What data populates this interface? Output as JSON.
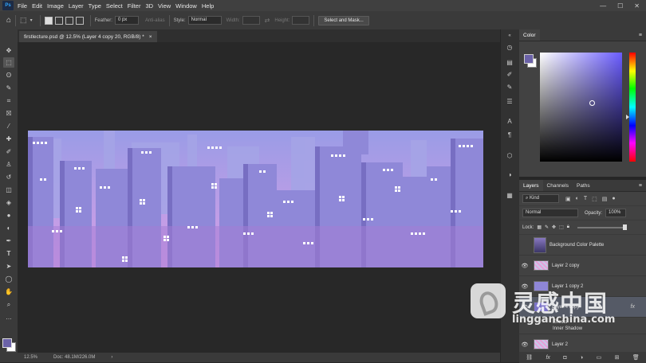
{
  "menu": {
    "app_icon_label": "Ps",
    "items": [
      "File",
      "Edit",
      "Image",
      "Layer",
      "Type",
      "Select",
      "Filter",
      "3D",
      "View",
      "Window",
      "Help"
    ],
    "window_controls": [
      "—",
      "☐",
      "✕"
    ]
  },
  "options_bar": {
    "feather_label": "Feather:",
    "feather_value": "0 px",
    "antialias_label": "Anti-alias",
    "style_label": "Style:",
    "style_value": "Normal",
    "width_label": "Width:",
    "height_label": "Height:",
    "select_mask_button": "Select and Mask..."
  },
  "document": {
    "tab_title": "firstlecture.psd @ 12.5% (Layer 4 copy 20, RGB/8) *",
    "close_glyph": "×"
  },
  "status": {
    "zoom": "12.5%",
    "doc_size": "Doc: 48.1M/226.0M",
    "arrow": "›"
  },
  "color_panel": {
    "title": "Color",
    "fg_color": "#6b62a8",
    "bg_color": "#ffffff",
    "menu_glyph": "≡"
  },
  "layers_panel": {
    "tabs": [
      "Layers",
      "Channels",
      "Paths"
    ],
    "menu_glyph": "≡",
    "kind_label": "Kind",
    "blend_mode": "Normal",
    "opacity_label": "Opacity:",
    "opacity_value": "100%",
    "lock_label": "Lock:",
    "layers": [
      {
        "name": "Background Color Palette",
        "visible": false,
        "thumb": "palette"
      },
      {
        "name": "Layer 2 copy",
        "visible": true,
        "thumb": "pattern"
      },
      {
        "name": "Layer 1 copy 2",
        "visible": true,
        "thumb": "pattern"
      },
      {
        "name": "Layer 4 copy",
        "visible": true,
        "thumb": "pattern",
        "selected": true,
        "fx": "fx"
      },
      {
        "name": "Layer 2",
        "visible": true,
        "thumb": "pattern"
      }
    ],
    "effects_label": "Effects",
    "inner_shadow_label": "Inner Shadow",
    "footer_icons": [
      "link-icon",
      "fx-icon",
      "mask-icon",
      "adjustment-icon",
      "group-icon",
      "new-layer-icon",
      "trash-icon"
    ]
  },
  "watermark": {
    "cn": "灵感中国",
    "en": "lingganchina.com"
  },
  "canvas_colors": {
    "sky_top": "#9a9ce6",
    "sky_bottom": "#d79ee6",
    "building_light": "#8f88d8",
    "building_dark": "#6f64b6",
    "ground": "#a47ed6",
    "window": "#ffffff"
  }
}
